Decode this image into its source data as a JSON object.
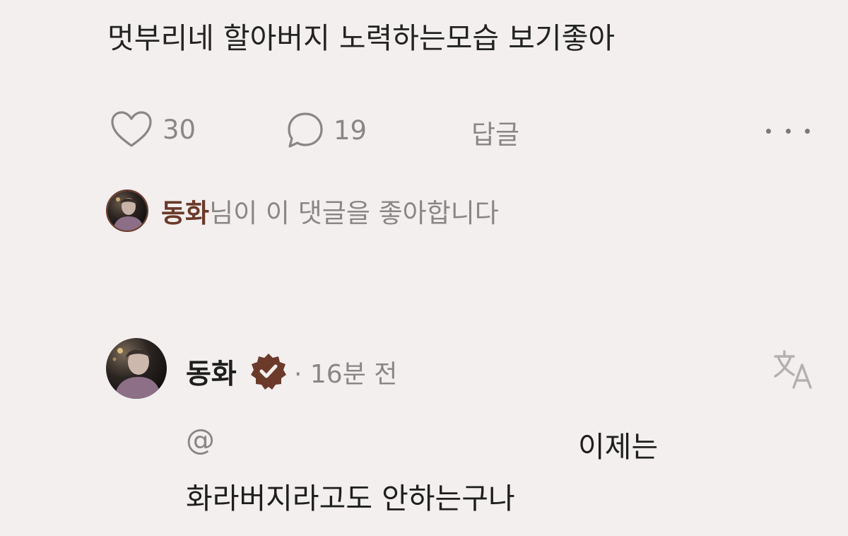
{
  "comment": {
    "text": "멋부리네 할아버지 노력하는모습 보기좋아"
  },
  "actions": {
    "like_count": "30",
    "reply_count": "19",
    "reply_label": "답글"
  },
  "liked_by": {
    "name": "동화",
    "suffix": "님이 이 댓글을 좋아합니다"
  },
  "reply": {
    "author": "동화",
    "time": "· 16분 전",
    "mention": "@",
    "line1_tail": "이제는",
    "line2": "화라버지라고도 안하는구나"
  },
  "colors": {
    "background": "#f2efee",
    "text": "#1e1e1e",
    "muted": "#8a8686",
    "brand_brown": "#6b3a2a"
  },
  "icons": {
    "like": "heart-outline-icon",
    "reply": "speech-bubble-icon",
    "more": "more-horizontal-icon",
    "verified": "verified-badge-icon",
    "translate": "translate-icon"
  }
}
